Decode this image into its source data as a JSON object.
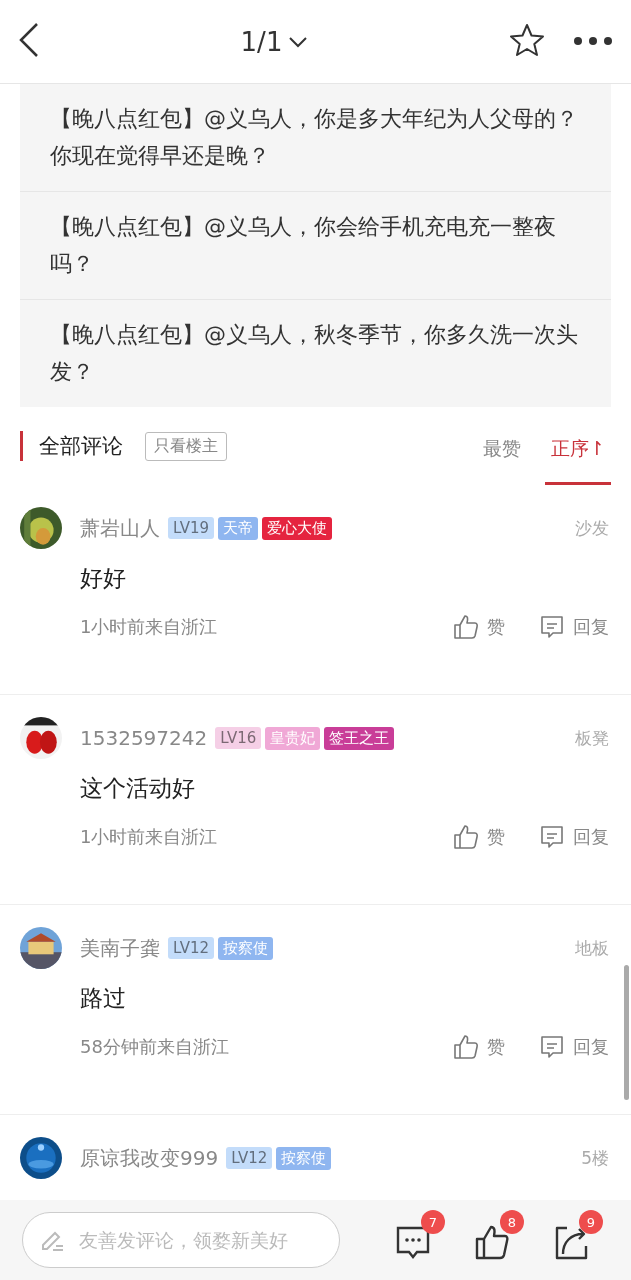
{
  "top_bar": {
    "page_indicator": "1/1"
  },
  "related_posts": [
    {
      "title": "【晚八点红包】@义乌人，你是多大年纪为人父母的？你现在觉得早还是晚？"
    },
    {
      "title": "【晚八点红包】@义乌人，你会给手机充电充一整夜吗？"
    },
    {
      "title": "【晚八点红包】@义乌人，秋冬季节，你多久洗一次头发？"
    }
  ],
  "comments_header": {
    "title": "全部评论",
    "filter": "只看楼主",
    "sort_tabs": [
      {
        "label": "最赞",
        "selected": false
      },
      {
        "label": "正序↾",
        "selected": true
      }
    ]
  },
  "comments": [
    {
      "name": "萧岩山人",
      "tags": [
        {
          "text": "LV19",
          "color": "#c3dcfa",
          "kind": "level"
        },
        {
          "text": "天帝",
          "color": "#8fb6f0"
        },
        {
          "text": "爱心大使",
          "color": "#e5243f"
        }
      ],
      "floor": "沙发",
      "body": "好好",
      "meta": "1小时前来自浙江",
      "like": "赞",
      "reply": "回复"
    },
    {
      "name": "1532597242",
      "tags": [
        {
          "text": "LV16",
          "color": "#f5cfe6",
          "kind": "level"
        },
        {
          "text": "皇贵妃",
          "color": "#f0a8d6"
        },
        {
          "text": "签王之王",
          "color": "#c93d98"
        }
      ],
      "floor": "板凳",
      "body": "这个活动好",
      "meta": "1小时前来自浙江",
      "like": "赞",
      "reply": "回复"
    },
    {
      "name": "美南子龚",
      "tags": [
        {
          "text": "LV12",
          "color": "#c3dcfa",
          "kind": "level"
        },
        {
          "text": "按察使",
          "color": "#8fb6f0"
        }
      ],
      "floor": "地板",
      "body": "路过",
      "meta": "58分钟前来自浙江",
      "like": "赞",
      "reply": "回复"
    },
    {
      "name": "原谅我改变999",
      "tags": [
        {
          "text": "LV12",
          "color": "#c3dcfa",
          "kind": "level"
        },
        {
          "text": "按察使",
          "color": "#8fb6f0"
        }
      ],
      "floor": "5楼"
    }
  ],
  "bottom_bar": {
    "placeholder": "友善发评论，领婺新美好",
    "comment_count": "7",
    "like_count": "8",
    "share_count": "9"
  }
}
